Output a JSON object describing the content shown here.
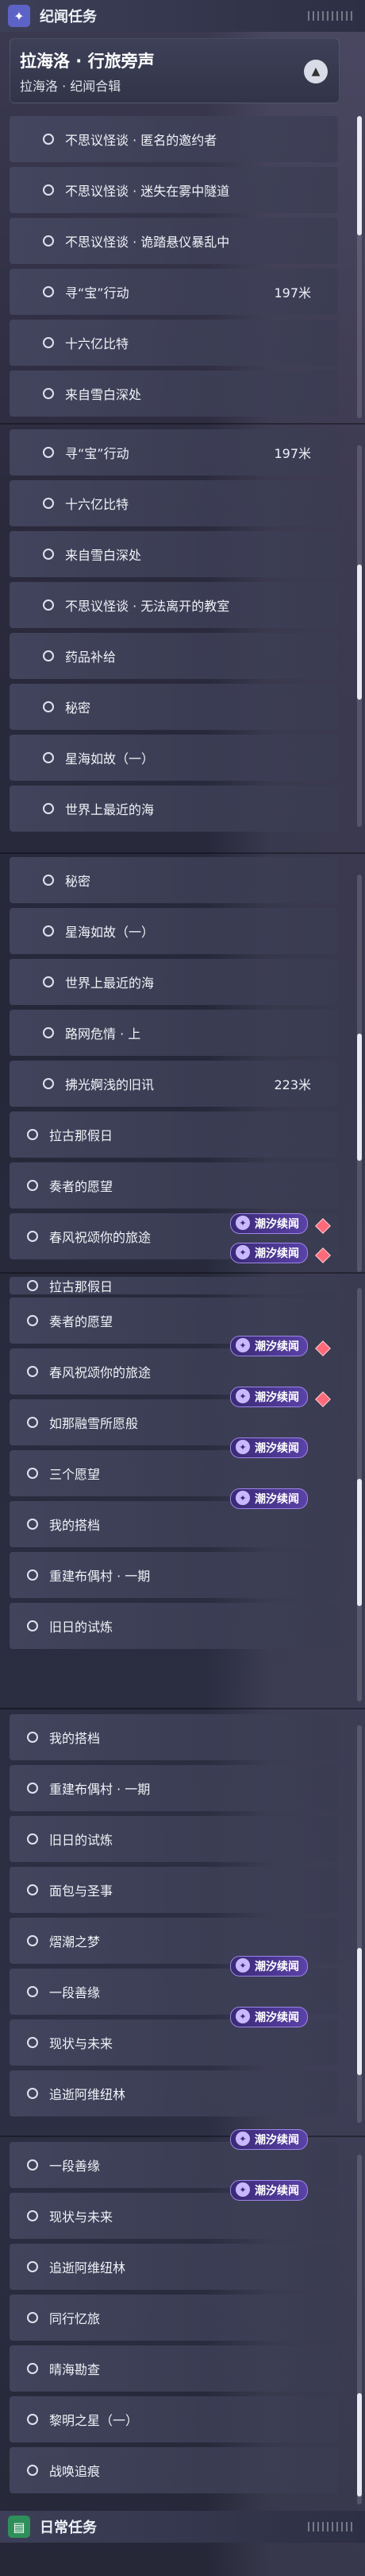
{
  "headers": {
    "world": {
      "label": "纪闻任务",
      "icon": "sparkle-icon"
    },
    "daily": {
      "label": "日常任务",
      "icon": "calendar-icon"
    }
  },
  "group": {
    "title": "拉海洛 · 行旅旁声",
    "subtitle": "拉海洛 · 纪闻合辑"
  },
  "tag_label": "潮汐续闻",
  "quests": {
    "q1": "不思议怪谈 · 匿名的邀约者",
    "q2": "不思议怪谈 · 迷失在雾中隧道",
    "q3": "不思议怪谈 · 诡踏悬仪暴乱中",
    "q4": "寻“宝”行动",
    "q5": "十六亿比特",
    "q6": "来自雪白深处",
    "q7": "不思议怪谈 · 无法离开的教室",
    "q8": "药品补给",
    "q9": "秘密",
    "q10": "星海如故（一）",
    "q11": "世界上最近的海",
    "q12": "路网危情 · 上",
    "q13": "拂光婀浅的旧讯",
    "q14": "拉古那假日",
    "q15": "奏者的愿望",
    "q16": "春风祝颂你的旅途",
    "q17": "如那融雪所愿般",
    "q18": "三个愿望",
    "q19": "我的搭档",
    "q20": "重建布偶村 · 一期",
    "q21": "旧日的试炼",
    "q22": "面包与圣事",
    "q23": "熠潮之梦",
    "q24": "一段善缘",
    "q25": "现状与未来",
    "q26": "追逝阿维纽林",
    "q27": "同行忆旅",
    "q28": "晴海勘查",
    "q29": "黎明之星（一）",
    "q30": "战唤追痕"
  },
  "distances": {
    "treasure": "197米",
    "old_news": "223米"
  },
  "colors": {
    "accent": "#5d63c6",
    "tag": "#5a42a8",
    "alert": "#ff6a7a",
    "daily": "#2f8f5a"
  }
}
